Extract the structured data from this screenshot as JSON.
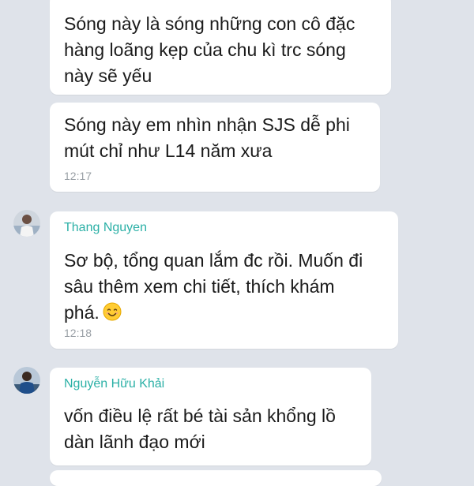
{
  "messages": [
    {
      "text": "Sóng này là sóng những con cô đặc\nhàng loãng kẹp của chu kì trc sóng\nnày sẽ yếu"
    },
    {
      "text": "Sóng này em nhìn nhận SJS dễ phi\nmút chỉ như L14 năm xưa",
      "time": "12:17"
    },
    {
      "sender": "Thang Nguyen",
      "text": "Sơ bộ, tổng quan lắm đc rồi. Muốn đi\nsâu thêm xem chi tiết, thích khám\nphá.",
      "emoji": "smiling-face-emoji",
      "time": "12:18"
    },
    {
      "sender": "Nguyễn Hữu Khải",
      "text": "vốn điều lệ rất bé tài sản khổng lồ\ndàn lãnh đạo mới"
    }
  ],
  "colors": {
    "background": "#dfe3ea",
    "bubble": "#ffffff",
    "sender_name": "#2bb0a6",
    "timestamp": "#9aa0a6"
  }
}
